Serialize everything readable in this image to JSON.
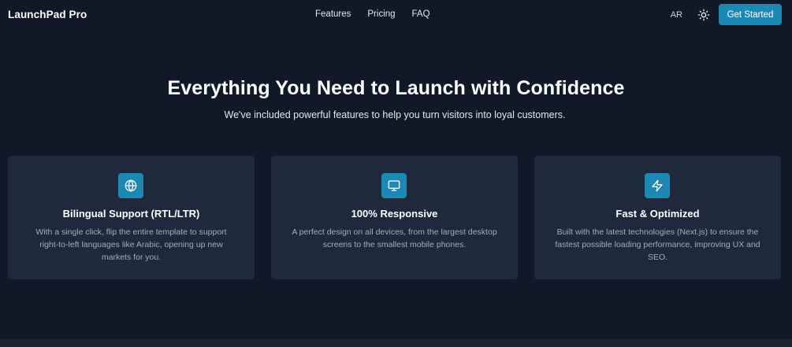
{
  "navbar": {
    "brand": "LaunchPad Pro",
    "links": [
      "Features",
      "Pricing",
      "FAQ"
    ],
    "language_toggle": "AR",
    "theme_icon": "sun-icon",
    "cta_label": "Get Started"
  },
  "hero": {
    "title": "Everything You Need to Launch with Confidence",
    "subtitle": "We've included powerful features to help you turn visitors into loyal customers."
  },
  "features": [
    {
      "icon": "globe-icon",
      "title": "Bilingual Support (RTL/LTR)",
      "description": "With a single click, flip the entire template to support right-to-left languages like Arabic, opening up new markets for you."
    },
    {
      "icon": "monitor-icon",
      "title": "100% Responsive",
      "description": "A perfect design on all devices, from the largest desktop screens to the smallest mobile phones."
    },
    {
      "icon": "zap-icon",
      "title": "Fast & Optimized",
      "description": "Built with the latest technologies (Next.js) to ensure the fastest possible loading performance, improving UX and SEO."
    }
  ],
  "colors": {
    "background": "#111827",
    "card": "#1e293b",
    "accent": "#1e88b4"
  }
}
